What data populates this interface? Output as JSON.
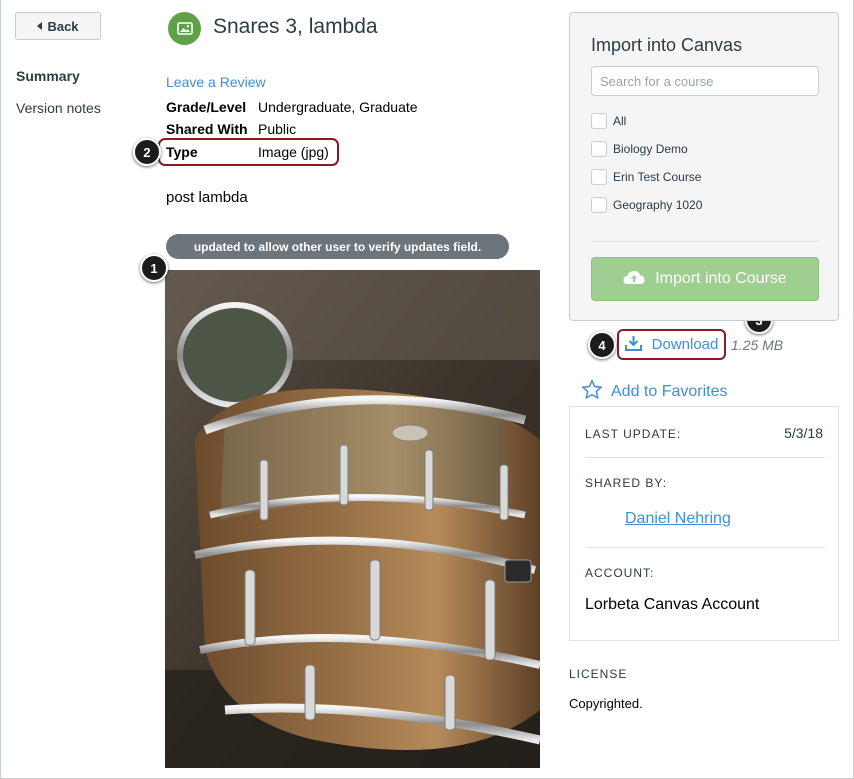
{
  "nav": {
    "back_label": "Back",
    "summary": "Summary",
    "version_notes": "Version notes"
  },
  "resource": {
    "title": "Snares 3, lambda",
    "leave_review": "Leave a Review",
    "meta": [
      {
        "key": "Grade/Level",
        "value": "Undergraduate, Graduate"
      },
      {
        "key": "Shared With",
        "value": "Public"
      },
      {
        "key": "Type",
        "value": "Image (jpg)"
      }
    ],
    "description": "post lambda",
    "version_note": "updated to allow other user to verify updates field."
  },
  "import_panel": {
    "title": "Import into Canvas",
    "search_placeholder": "Search for a course",
    "courses": [
      "All",
      "Biology Demo",
      "Erin Test Course",
      "Geography 1020"
    ],
    "import_button": "Import into Course"
  },
  "download": {
    "label": "Download",
    "size": "1.25 MB"
  },
  "favorites": {
    "label": "Add to Favorites"
  },
  "info": {
    "last_update_label": "LAST UPDATE:",
    "last_update_value": "5/3/18",
    "shared_by_label": "SHARED BY:",
    "shared_by_value": "Daniel Nehring",
    "account_label": "ACCOUNT:",
    "account_value": "Lorbeta Canvas Account"
  },
  "license": {
    "label": "LICENSE",
    "value": "Copyrighted."
  },
  "callouts": [
    "1",
    "2",
    "3",
    "4"
  ],
  "colors": {
    "link": "#3f8fd8",
    "highlight": "#8a1b22",
    "import_button": "#9fcf90",
    "type_icon": "#5fa148"
  },
  "icons": {
    "type": "image-icon",
    "back": "caret-left-icon",
    "import": "cloud-upload-icon",
    "download": "download-icon",
    "favorite": "star-outline-icon"
  }
}
